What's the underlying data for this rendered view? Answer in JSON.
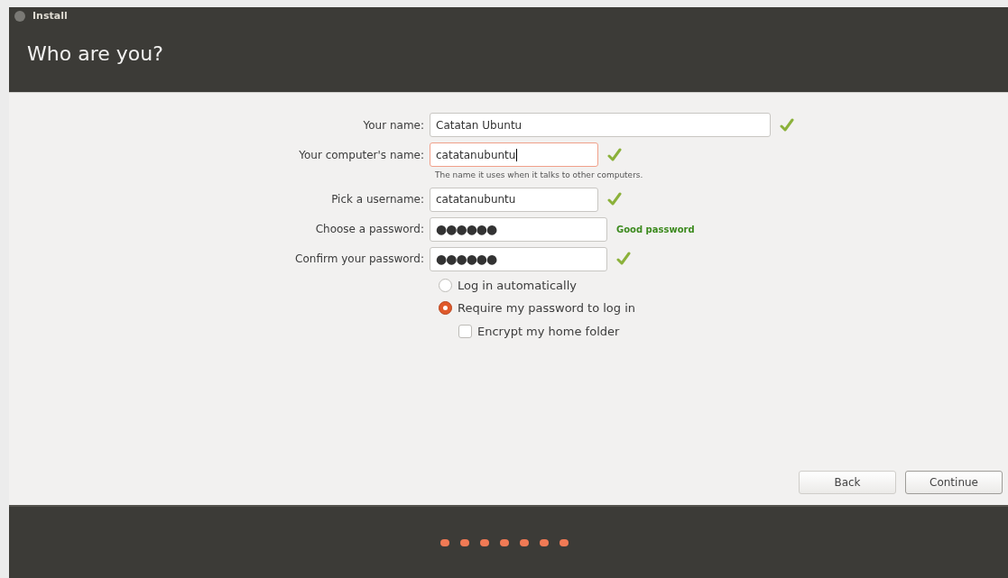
{
  "window": {
    "title": "Install"
  },
  "heading": "Who are you?",
  "fields": [
    {
      "label": "Your name:",
      "kind": "text",
      "value": "Catatan Ubuntu",
      "focused": false,
      "status": {
        "kind": "check"
      }
    },
    {
      "label": "Your computer's name:",
      "kind": "text",
      "value": "catatanubuntu",
      "focused": true,
      "status": {
        "kind": "check"
      },
      "hint": "The name it uses when it talks to other computers."
    },
    {
      "label": "Pick a username:",
      "kind": "text",
      "value": "catatanubuntu",
      "focused": false,
      "status": {
        "kind": "check"
      }
    },
    {
      "label": "Choose a password:",
      "kind": "password",
      "value": "●●●●●●",
      "focused": false,
      "status": {
        "kind": "text",
        "text": "Good password"
      }
    },
    {
      "label": "Confirm your password:",
      "kind": "password",
      "value": "●●●●●●",
      "focused": false,
      "status": {
        "kind": "check"
      }
    }
  ],
  "login_options": [
    {
      "label": "Log in automatically",
      "selected": false
    },
    {
      "label": "Require my password to log in",
      "selected": true
    }
  ],
  "encrypt": {
    "label": "Encrypt my home folder",
    "checked": false
  },
  "buttons": [
    {
      "label": "Back",
      "kind": "default"
    },
    {
      "label": "Continue",
      "kind": "primary"
    }
  ],
  "progress": [
    {
      "done": true
    },
    {
      "done": true
    },
    {
      "done": true
    },
    {
      "done": true
    },
    {
      "done": true
    },
    {
      "done": true
    },
    {
      "done": true
    }
  ]
}
